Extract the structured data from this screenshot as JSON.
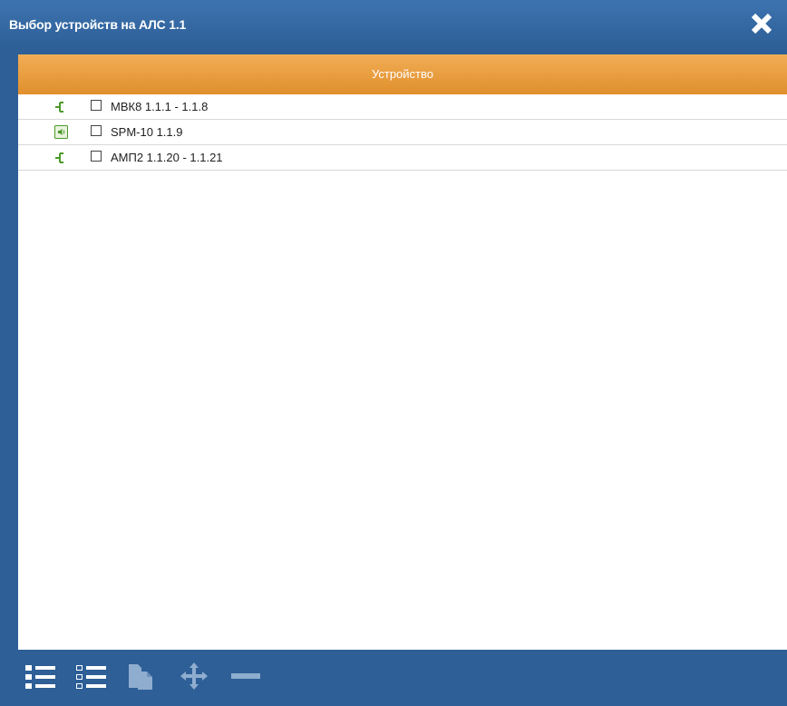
{
  "window": {
    "title": "Выбор устройств на АЛС 1.1"
  },
  "table": {
    "header": "Устройство",
    "rows": [
      {
        "icon": "branch-icon",
        "label": "МВК8 1.1.1 - 1.1.8",
        "checked": false
      },
      {
        "icon": "speaker-icon",
        "label": "SPM-10 1.1.9",
        "checked": false
      },
      {
        "icon": "branch-icon",
        "label": "АМП2 1.1.20 - 1.1.21",
        "checked": false
      }
    ]
  },
  "toolbar": {
    "buttons": [
      "expand-all-icon",
      "collapse-all-icon",
      "copy-icon",
      "move-icon",
      "remove-icon"
    ]
  },
  "colors": {
    "titlebar": "#2e5f97",
    "header_accent": "#e8962f",
    "icon_green": "#4d9a2a"
  }
}
